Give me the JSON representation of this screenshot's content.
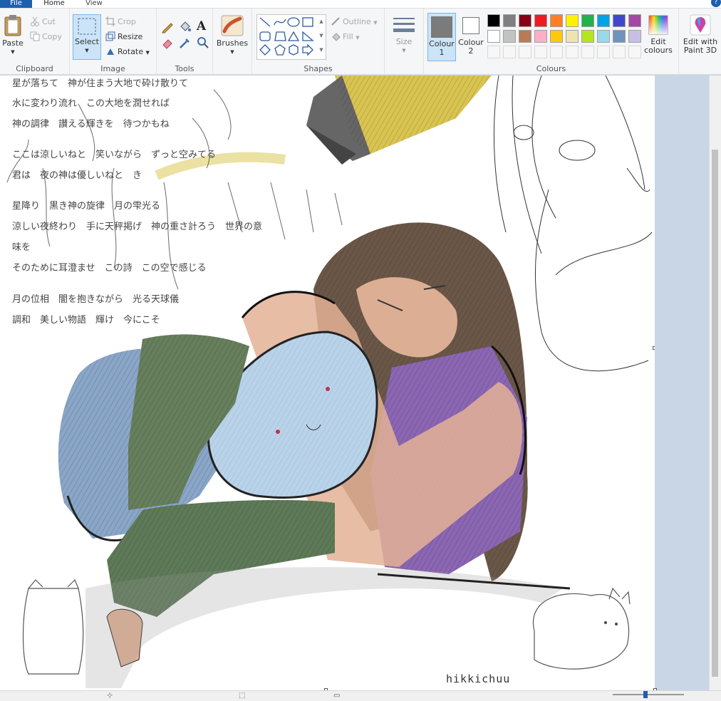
{
  "menu": {
    "file": "File",
    "home": "Home",
    "view": "View",
    "help": "?"
  },
  "ribbon": {
    "clipboard": {
      "label": "Clipboard",
      "paste": "Paste",
      "cut": "Cut",
      "copy": "Copy"
    },
    "image": {
      "label": "Image",
      "select": "Select",
      "crop": "Crop",
      "resize": "Resize",
      "rotate": "Rotate"
    },
    "tools": {
      "label": "Tools"
    },
    "brushes": {
      "label": "Brushes"
    },
    "shapes": {
      "label": "Shapes",
      "outline": "Outline",
      "fill": "Fill"
    },
    "size": {
      "label": "Size"
    },
    "colours": {
      "label": "Colours",
      "colour1": "Colour 1",
      "colour2": "Colour 2",
      "edit": "Edit colours",
      "colour1_value": "#7b7b7b",
      "colour2_value": "#ffffff",
      "palette_row1": [
        "#000000",
        "#7f7f7f",
        "#880015",
        "#ed1c24",
        "#ff7f27",
        "#fff200",
        "#22b14c",
        "#00a2e8",
        "#3f48cc",
        "#a349a4"
      ],
      "palette_row2": [
        "#ffffff",
        "#c3c3c3",
        "#b97a57",
        "#ffaec9",
        "#ffc90e",
        "#efe4b0",
        "#b5e61d",
        "#99d9ea",
        "#7092be",
        "#c8bfe7"
      ]
    },
    "paint3d": {
      "label": "Edit with Paint 3D"
    }
  },
  "poem": [
    "星が落ちて　神が住まう大地で砕け散りて",
    "水に変わり流れ　この大地を潤せれば",
    "神の調律　讃える輝きを　待つかもね",
    "ここは涼しいねと　笑いながら　ずっと空みてる",
    "君は　夜の神は優しいねと　き",
    "星降り　黒き神の旋律　月の雫光る",
    "涼しい夜終わり　手に天秤掲げ　神の重さ計ろう　世界の意",
    "味を",
    "そのために耳澄ませ　この詩　この空で感じる",
    "月の位相　闇を抱きながら　光る天球儀",
    "調和　美しい物語　輝け　今にこそ"
  ],
  "signature": "hikkichuu"
}
